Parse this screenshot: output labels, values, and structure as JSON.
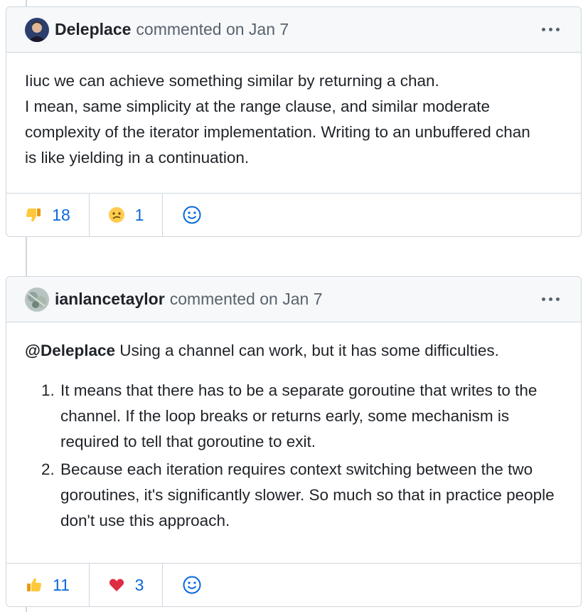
{
  "comments": [
    {
      "author": "Deleplace",
      "meta": "commented on Jan 7",
      "body_lines": [
        "Iiuc we can achieve something similar by returning a chan.",
        "I mean, same simplicity at the range clause, and similar moderate",
        "complexity of the iterator implementation. Writing to an unbuffered chan",
        "is like yielding in a continuation."
      ],
      "reactions": [
        {
          "emoji": "thumbs-down-icon",
          "count": "18"
        },
        {
          "emoji": "confused-face-icon",
          "count": "1"
        }
      ]
    },
    {
      "author": "ianlancetaylor",
      "meta": "commented on Jan 7",
      "mention": "@Deleplace",
      "intro": " Using a channel can work, but it has some difficulties.",
      "list_items": [
        "It means that there has to be a separate goroutine that writes to the channel. If the loop breaks or returns early, some mechanism is required to tell that goroutine to exit.",
        "Because each iteration requires context switching between the two goroutines, it's significantly slower. So much so that in practice people don't use this approach."
      ],
      "reactions": [
        {
          "emoji": "thumbs-up-icon",
          "count": "11"
        },
        {
          "emoji": "red-heart-icon",
          "count": "3"
        }
      ]
    }
  ],
  "colors": {
    "link": "#0969da",
    "border": "#d0d7de",
    "header_bg": "#f6f8fa",
    "muted": "#59636e"
  }
}
